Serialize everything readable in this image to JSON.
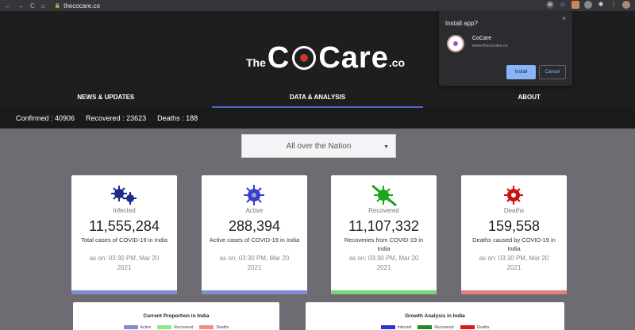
{
  "browser": {
    "url": "thecocare.co",
    "nav": [
      "←",
      "→",
      "C",
      "⌂"
    ],
    "lock": "🔒"
  },
  "logo": {
    "prefix": "The",
    "main_left": "C",
    "main_right": "Care",
    "suffix": ".co"
  },
  "tabs": [
    {
      "label": "NEWS & UPDATES",
      "active": false
    },
    {
      "label": "DATA & ANALYSIS",
      "active": true
    },
    {
      "label": "ABOUT",
      "active": false
    }
  ],
  "stats": {
    "confirmed": "Confirmed : 40906",
    "recovered": "Recovered : 23623",
    "deaths": "Deaths : 188"
  },
  "region_select": {
    "value": "All over the Nation"
  },
  "cards": [
    {
      "title": "Infected",
      "value": "11,555,284",
      "desc": "Total cases of COVID-19 in India",
      "asof": "as on: 03:30 PM, Mar 20 2021",
      "color": "#7d8fd1",
      "icon_color": "#1a2b8c"
    },
    {
      "title": "Active",
      "value": "288,394",
      "desc": "Active cases of COVID-19 in India",
      "asof": "as on: 03:30 PM, Mar 20 2021",
      "color": "#7d8fd1",
      "icon_color": "#3a3ad4"
    },
    {
      "title": "Recovered",
      "value": "11,107,332",
      "desc": "Recoveries from COVID-19 in India",
      "asof": "as on: 03:30 PM, Mar 20 2021",
      "color": "#79d67a",
      "icon_color": "#1aa51a"
    },
    {
      "title": "Deaths",
      "value": "159,558",
      "desc": "Deaths caused by COVID-19 in India",
      "asof": "as on: 03:30 PM, Mar 20 2021",
      "color": "#e08080",
      "icon_color": "#cc1111"
    }
  ],
  "panels": [
    {
      "title": "Current Proportion in India",
      "legend": [
        {
          "label": "Active",
          "color": "#7d8fd1"
        },
        {
          "label": "Recovered",
          "color": "#8ee88e"
        },
        {
          "label": "Deaths",
          "color": "#ef8d8d"
        }
      ]
    },
    {
      "title": "Growth Analysis in India",
      "legend": [
        {
          "label": "Infected",
          "color": "#2a36c9"
        },
        {
          "label": "Recovered",
          "color": "#1f8a1f"
        },
        {
          "label": "Deaths",
          "color": "#d91a1a"
        }
      ]
    }
  ],
  "install_popup": {
    "title": "Install app?",
    "app_name": "CoCare",
    "app_url": "www.thecocare.co",
    "install_label": "Install",
    "cancel_label": "Cancel",
    "close": "×"
  }
}
